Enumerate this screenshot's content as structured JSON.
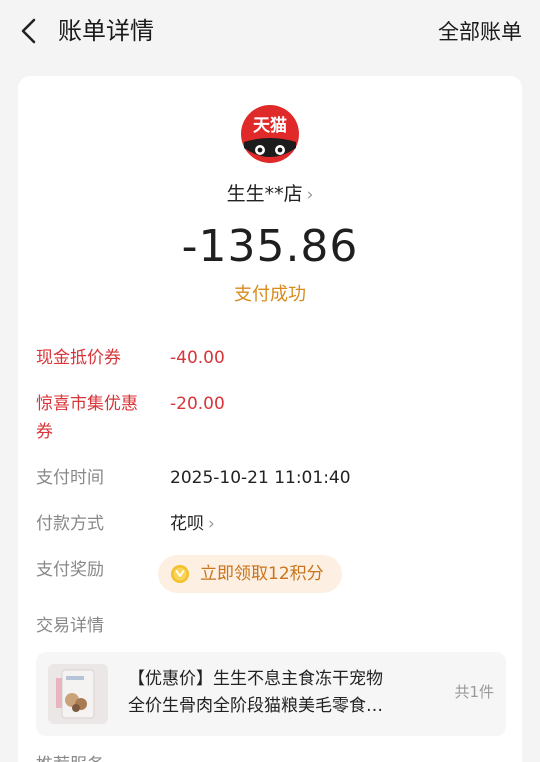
{
  "header": {
    "title": "账单详情",
    "right_link": "全部账单"
  },
  "merchant": {
    "logo_text": "天猫",
    "name": "生生**店",
    "chevron": "›"
  },
  "amount": "-135.86",
  "status": "支付成功",
  "discounts": [
    {
      "label": "现金抵价券",
      "value": "-40.00"
    },
    {
      "label_line1": "惊喜市集优惠",
      "label_line2": "券",
      "value": "-20.00"
    }
  ],
  "details": {
    "pay_time_label": "支付时间",
    "pay_time_value": "2025-10-21 11:01:40",
    "pay_method_label": "付款方式",
    "pay_method_value": "花呗",
    "reward_label": "支付奖励",
    "reward_value": "立即领取12积分",
    "trade_label": "交易详情"
  },
  "product": {
    "title_line1": "【优惠价】生生不息主食冻干宠物",
    "title_line2": "全价生骨肉全阶段猫粮美毛零食…",
    "qty": "共1件"
  },
  "bottom_partial_label": "推荐服务",
  "colors": {
    "accent_orange": "#d88a1c",
    "discount_red": "#d7353a",
    "tmall_red": "#e02a2a"
  },
  "icons": {
    "back": "back-arrow-icon",
    "logo": "tmall-cat-logo",
    "reward": "points-coin-icon"
  }
}
